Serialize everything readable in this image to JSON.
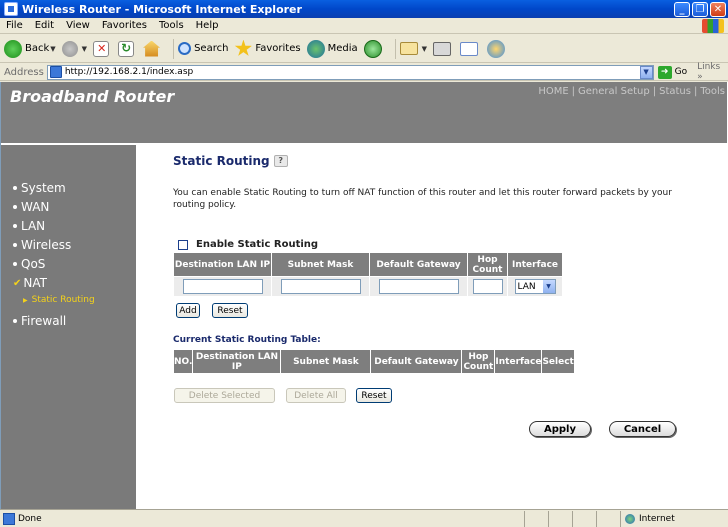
{
  "window": {
    "title": "Wireless Router - Microsoft Internet Explorer",
    "min": "_",
    "max": "❐",
    "close": "✕"
  },
  "menu": [
    "File",
    "Edit",
    "View",
    "Favorites",
    "Tools",
    "Help"
  ],
  "toolbar": {
    "back": "Back",
    "search": "Search",
    "favorites": "Favorites",
    "media": "Media"
  },
  "address": {
    "label": "Address",
    "url": "http://192.168.2.1/index.asp",
    "go": "Go",
    "links": "Links"
  },
  "header": {
    "brand": "Broadband Router",
    "nav": [
      "HOME",
      "General Setup",
      "Status",
      "Tools"
    ]
  },
  "sidebar": {
    "items": [
      {
        "label": "System",
        "marker": "bullet"
      },
      {
        "label": "WAN",
        "marker": "bullet"
      },
      {
        "label": "LAN",
        "marker": "bullet"
      },
      {
        "label": "Wireless",
        "marker": "bullet"
      },
      {
        "label": "QoS",
        "marker": "bullet"
      },
      {
        "label": "NAT",
        "marker": "check"
      },
      {
        "label": "Firewall",
        "marker": "bullet"
      }
    ],
    "sub_item": "Static Routing"
  },
  "page": {
    "title": "Static Routing",
    "description": "You can enable Static Routing to turn off NAT function of this router and let this router forward packets by your routing policy.",
    "enable_label": "Enable Static Routing",
    "entry_table": {
      "headers": [
        "Destination LAN IP",
        "Subnet Mask",
        "Default Gateway",
        "Hop Count",
        "Interface"
      ],
      "interface_value": "LAN"
    },
    "add_label": "Add",
    "reset_label": "Reset",
    "current_table_title": "Current Static Routing Table:",
    "current_table": {
      "headers": [
        "NO.",
        "Destination LAN IP",
        "Subnet Mask",
        "Default Gateway",
        "Hop Count",
        "Interface",
        "Select"
      ]
    },
    "delete_selected_label": "Delete Selected",
    "delete_all_label": "Delete All",
    "reset2_label": "Reset",
    "apply_label": "Apply",
    "cancel_label": "Cancel"
  },
  "status": {
    "text": "Done",
    "zone": "Internet"
  }
}
